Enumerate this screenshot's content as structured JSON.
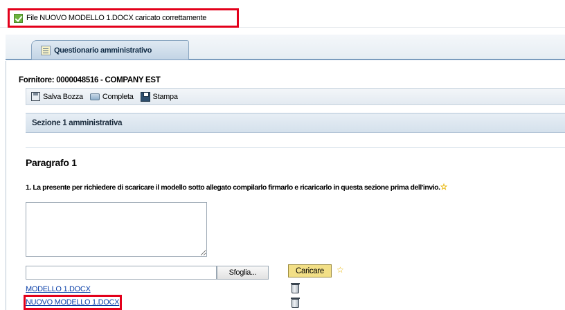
{
  "message": {
    "icon": "success-check-icon",
    "text": "File NUOVO MODELLO 1.DOCX caricato correttamente"
  },
  "tab": {
    "icon": "questionnaire-icon",
    "label": "Questionario amministrativo"
  },
  "supplier_line": "Fornitore: 0000048516 - COMPANY EST",
  "toolbar": {
    "save_label": "Salva Bozza",
    "complete_label": "Completa",
    "print_label": "Stampa"
  },
  "section_title": "Sezione 1 amministrativa",
  "paragraph_title": "Paragrafo 1",
  "question": "1. La presente per richiedere di scaricare il modello sotto allegato compilarlo firmarlo e ricaricarlo in questa sezione prima dell'invio.",
  "answer_text": "",
  "file_input_value": "",
  "browse_label": "Sfoglia...",
  "upload_label": "Caricare",
  "required_marker": "☆",
  "attachments": [
    {
      "name": "MODELLO 1.DOCX",
      "action_icon": "delete-trash-icon"
    },
    {
      "name": "NUOVO MODELLO 1.DOCX",
      "action_icon": "delete-trash-icon"
    }
  ],
  "colors": {
    "highlight": "#e3001b",
    "link": "#0a3fa8",
    "upload_button": "#f2df86"
  }
}
